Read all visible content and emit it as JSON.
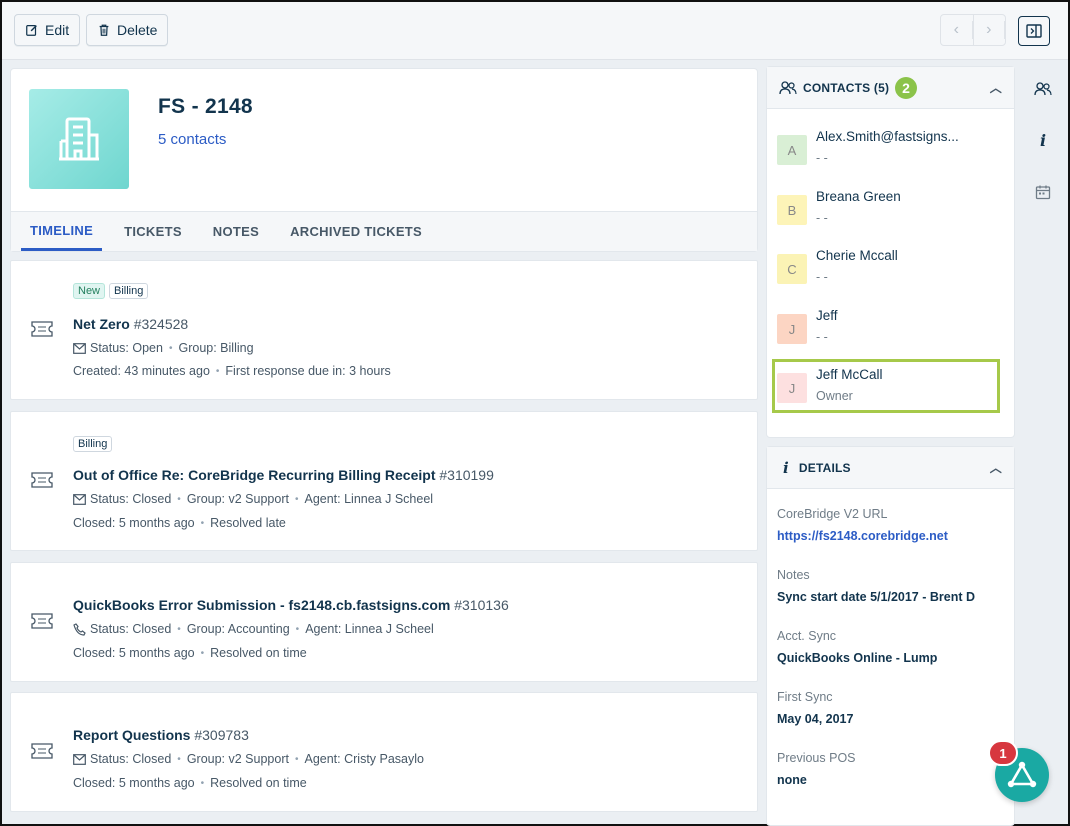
{
  "toolbar": {
    "edit_label": "Edit",
    "delete_label": "Delete"
  },
  "company": {
    "name": "FS - 2148",
    "contacts_link": "5 contacts"
  },
  "tabs": [
    {
      "label": "TIMELINE",
      "active": true
    },
    {
      "label": "TICKETS",
      "active": false
    },
    {
      "label": "NOTES",
      "active": false
    },
    {
      "label": "ARCHIVED TICKETS",
      "active": false
    }
  ],
  "tickets": [
    {
      "tags": [
        "New",
        "Billing"
      ],
      "title": "Net Zero",
      "id": "#324528",
      "source_icon": "mail-icon",
      "line1": [
        "Status: Open",
        "Group: Billing"
      ],
      "line2": [
        "Created: 43 minutes ago",
        "First response due in: 3 hours"
      ]
    },
    {
      "tags": [
        "Billing"
      ],
      "title": "Out of Office Re: CoreBridge Recurring Billing Receipt",
      "id": "#310199",
      "source_icon": "mail-icon",
      "line1": [
        "Status: Closed",
        "Group: v2 Support",
        "Agent: Linnea J Scheel"
      ],
      "line2": [
        "Closed: 5 months ago",
        "Resolved late"
      ]
    },
    {
      "tags": [],
      "title": "QuickBooks Error Submission - fs2148.cb.fastsigns.com",
      "id": "#310136",
      "source_icon": "phone-icon",
      "line1": [
        "Status: Closed",
        "Group: Accounting",
        "Agent: Linnea J Scheel"
      ],
      "line2": [
        "Closed: 5 months ago",
        "Resolved on time"
      ]
    },
    {
      "tags": [],
      "title": "Report Questions",
      "id": "#309783",
      "source_icon": "mail-icon",
      "line1": [
        "Status: Closed",
        "Group: v2 Support",
        "Agent: Cristy Pasaylo"
      ],
      "line2": [
        "Closed: 5 months ago",
        "Resolved on time"
      ]
    }
  ],
  "contacts_panel": {
    "title": "CONTACTS (5)",
    "step_badge": "2",
    "contacts": [
      {
        "initial": "A",
        "name": "Alex.Smith@fastsigns...",
        "sub": "- -",
        "bg": "#d9efd5"
      },
      {
        "initial": "B",
        "name": "Breana Green",
        "sub": "- -",
        "bg": "#fdf4b8"
      },
      {
        "initial": "C",
        "name": "Cherie Mccall",
        "sub": "- -",
        "bg": "#fbf3b5"
      },
      {
        "initial": "J",
        "name": "Jeff",
        "sub": "- -",
        "bg": "#fcd5c3"
      },
      {
        "initial": "J",
        "name": "Jeff McCall",
        "sub": "Owner",
        "bg": "#fde0e0"
      }
    ]
  },
  "details_panel": {
    "title": "DETAILS",
    "fields": [
      {
        "label": "CoreBridge V2 URL",
        "value": "https://fs2148.corebridge.net",
        "link": true
      },
      {
        "label": "Notes",
        "value": "Sync start date 5/1/2017 - Brent D",
        "link": false
      },
      {
        "label": "Acct. Sync",
        "value": "QuickBooks Online - Lump",
        "link": false
      },
      {
        "label": "First Sync",
        "value": "May 04, 2017",
        "link": false
      },
      {
        "label": "Previous POS",
        "value": "none",
        "link": false
      }
    ]
  },
  "fab": {
    "badge": "1"
  },
  "colors": {
    "accent": "#2c5cc5",
    "highlight": "#a6c94a",
    "fab": "#1aa9a3",
    "badge": "#d7373f"
  }
}
